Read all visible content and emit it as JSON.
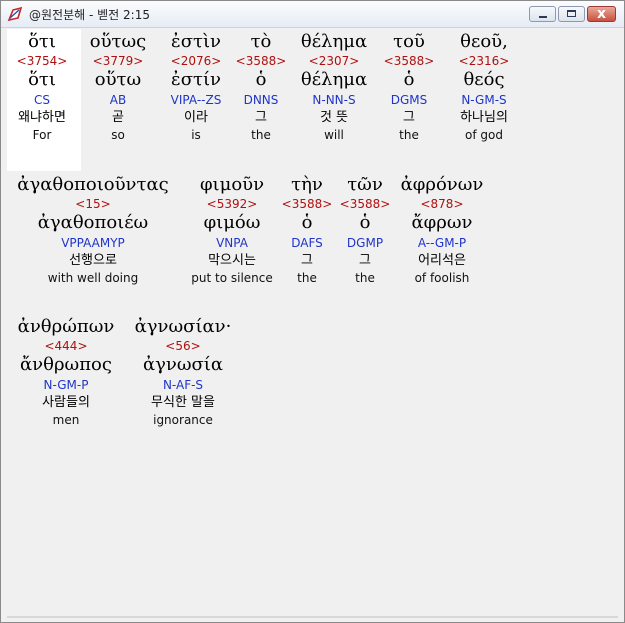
{
  "window": {
    "title": "@원전분해 - 벧전 2:15",
    "buttons": {
      "minimize": "minimize",
      "maximize": "maximize",
      "close": "x"
    }
  },
  "rows": [
    [
      {
        "greek": "ὅτι",
        "strong": "<3754>",
        "lemma": "ὅτι",
        "parse": "CS",
        "korean": "왜냐하면",
        "english": "For"
      },
      {
        "greek": "οὕτως",
        "strong": "<3779>",
        "lemma": "οὕτω",
        "parse": "AB",
        "korean": "곧",
        "english": "so"
      },
      {
        "greek": "ἐστὶν",
        "strong": "<2076>",
        "lemma": "ἐστίν",
        "parse": "VIPA--ZS",
        "korean": "이라",
        "english": "is"
      },
      {
        "greek": "τὸ",
        "strong": "<3588>",
        "lemma": "ὁ",
        "parse": "DNNS",
        "korean": "그",
        "english": "the"
      },
      {
        "greek": "θέλημα",
        "strong": "<2307>",
        "lemma": "θέλημα",
        "parse": "N-NN-S",
        "korean": "것 뜻",
        "english": "will"
      },
      {
        "greek": "τοῦ",
        "strong": "<3588>",
        "lemma": "ὁ",
        "parse": "DGMS",
        "korean": "그",
        "english": "the"
      },
      {
        "greek": "θεοῦ,",
        "strong": "<2316>",
        "lemma": "θεός",
        "parse": "N-GM-S",
        "korean": "하나님의",
        "english": "of god"
      }
    ],
    [
      {
        "greek": "ἀγαθοποιοῦντας",
        "strong": "<15>",
        "lemma": "ἀγαθοποιέω",
        "parse": "VPPAAMYP",
        "korean": "선행으로",
        "english": "with well doing"
      },
      {
        "greek": "φιμοῦν",
        "strong": "<5392>",
        "lemma": "φιμόω",
        "parse": "VNPA",
        "korean": "막으시는",
        "english": "put to silence"
      },
      {
        "greek": "τὴν",
        "strong": "<3588>",
        "lemma": "ὁ",
        "parse": "DAFS",
        "korean": "그",
        "english": "the"
      },
      {
        "greek": "τῶν",
        "strong": "<3588>",
        "lemma": "ὁ",
        "parse": "DGMP",
        "korean": "그",
        "english": "the"
      },
      {
        "greek": "ἀφρόνων",
        "strong": "<878>",
        "lemma": "ἄφρων",
        "parse": "A--GM-P",
        "korean": "어리석은",
        "english": "of foolish"
      }
    ],
    [
      {
        "greek": "ἀνθρώπων",
        "strong": "<444>",
        "lemma": "ἄνθρωπος",
        "parse": "N-GM-P",
        "korean": "사람들의",
        "english": "men"
      },
      {
        "greek": "ἀγνωσίαν·",
        "strong": "<56>",
        "lemma": "ἀγνωσία",
        "parse": "N-AF-S",
        "korean": "무식한 말을",
        "english": "ignorance"
      }
    ]
  ],
  "colors": {
    "strong": "#b01010",
    "parse": "#1f35c8",
    "highlight": "#ffffff"
  }
}
